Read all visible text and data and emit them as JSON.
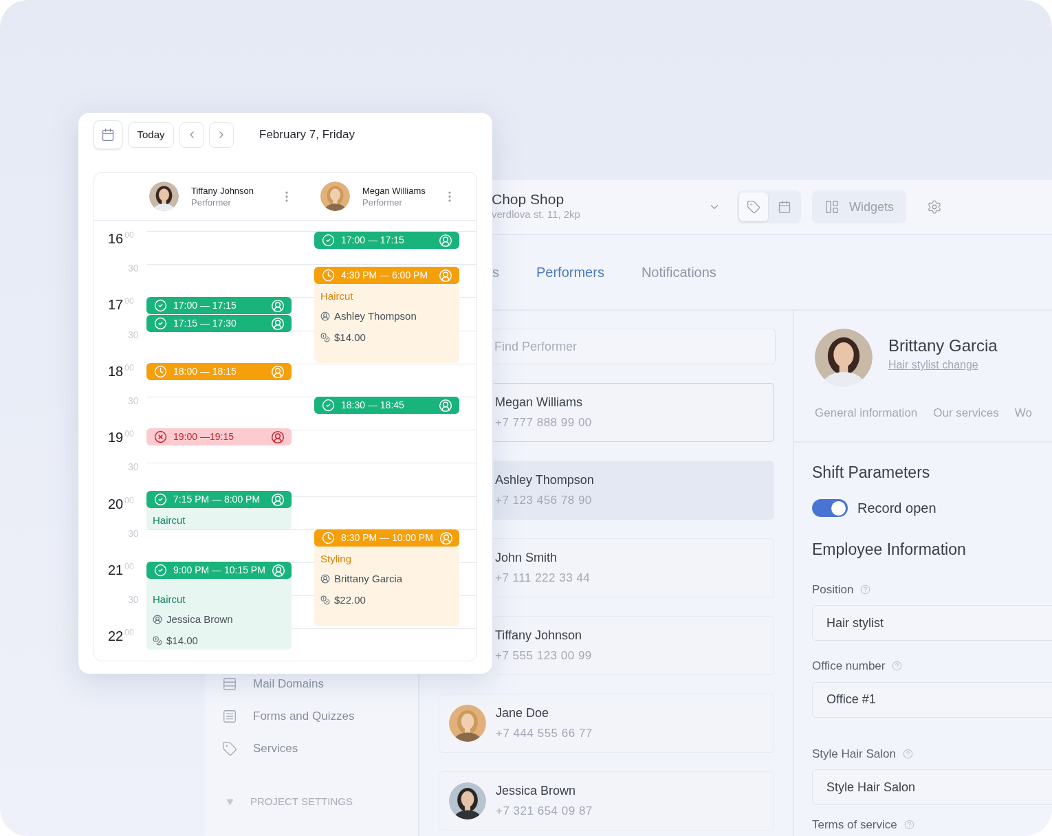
{
  "calendar": {
    "today": "Today",
    "date": "February 7, Friday",
    "performers": [
      {
        "name": "Tiffany Johnson",
        "role": "Performer",
        "photo": {
          "kind": "picture"
        }
      },
      {
        "name": "Megan Williams",
        "role": "Performer",
        "photo": {
          "kind": "picture"
        }
      }
    ],
    "time_labels": [
      {
        "kind": "hour",
        "hour": "16",
        "minutes": "00"
      },
      {
        "kind": "half",
        "minutes": "30"
      },
      {
        "kind": "hour",
        "hour": "17",
        "minutes": "00"
      },
      {
        "kind": "half",
        "minutes": "30"
      },
      {
        "kind": "hour",
        "hour": "18",
        "minutes": "00"
      },
      {
        "kind": "half",
        "minutes": "30"
      },
      {
        "kind": "hour",
        "hour": "19",
        "minutes": "00"
      },
      {
        "kind": "half",
        "minutes": "30"
      },
      {
        "kind": "hour",
        "hour": "20",
        "minutes": "00"
      },
      {
        "kind": "half",
        "minutes": "30"
      },
      {
        "kind": "hour",
        "hour": "21",
        "minutes": "00"
      },
      {
        "kind": "half",
        "minutes": "30"
      },
      {
        "kind": "hour",
        "hour": "22",
        "minutes": "00"
      }
    ],
    "columns": [
      {
        "events": [
          {
            "kind": "confirmed",
            "time": "17:00 — 17:15"
          },
          {
            "kind": "confirmed",
            "time": "17:15 — 17:30"
          },
          {
            "kind": "pending",
            "time": "18:00 — 18:15"
          },
          {
            "kind": "cancelled",
            "time": "19:00 —19:15"
          },
          {
            "kind": "confirmed",
            "time": "7:15 PM — 8:00 PM",
            "service": "Haircut"
          },
          {
            "kind": "confirmed",
            "time": "9:00 PM — 10:15 PM",
            "service": "Haircut",
            "client": "Jessica Brown",
            "price": "$14.00"
          }
        ]
      },
      {
        "events": [
          {
            "kind": "confirmed",
            "time": "17:00 — 17:15"
          },
          {
            "kind": "pending",
            "time": "4:30 PM — 6:00 PM",
            "service": "Haircut",
            "client": "Ashley Thompson",
            "price": "$14.00"
          },
          {
            "kind": "confirmed",
            "time": "18:30 — 18:45"
          },
          {
            "kind": "pending",
            "time": "8:30 PM — 10:00 PM",
            "service": "Styling",
            "client": "Brittany Garcia",
            "price": "$22.00"
          }
        ]
      }
    ]
  },
  "app": {
    "header": {
      "store_name": "Chop Shop",
      "store_address": "verdlova st. 11, 2kp",
      "view_toggle": [
        {
          "kind": "tag",
          "selected": true
        },
        {
          "kind": "calendar",
          "selected": false
        }
      ],
      "widgets": "Widgets"
    },
    "sidebar": {
      "items": [
        {
          "kind": "domains",
          "label": "Mail Domains"
        },
        {
          "kind": "forms",
          "label": "Forms and Quizzes"
        },
        {
          "kind": "tag",
          "label": "Services"
        }
      ],
      "section": "PROJECT SETTINGS"
    },
    "tabs": [
      {
        "label": "s",
        "selected": false
      },
      {
        "label": "Performers",
        "selected": true
      },
      {
        "label": "Notifications",
        "selected": false
      }
    ],
    "search": {
      "placeholder": "Find Performer"
    },
    "performers": [
      {
        "name": "Megan Williams",
        "phone": "+7 777 888 99 00",
        "selected": true,
        "highlighted": false
      },
      {
        "name": "Ashley Thompson",
        "phone": "+7 123 456 78 90",
        "selected": false,
        "highlighted": true
      },
      {
        "name": "John Smith",
        "phone": "+7 111 222 33 44",
        "selected": false,
        "highlighted": false
      },
      {
        "name": "Tiffany Johnson",
        "phone": "+7 555 123 00 99",
        "selected": false,
        "highlighted": false
      },
      {
        "name": "Jane Doe",
        "phone": "+7 444 555 66 77",
        "selected": false,
        "highlighted": false,
        "photo": {
          "kind": "picture"
        }
      },
      {
        "name": "Jessica Brown",
        "phone": "+7 321 654 09 87",
        "selected": false,
        "highlighted": false,
        "photo": {
          "kind": "picture"
        }
      }
    ],
    "profile": {
      "name": "Brittany Garcia",
      "link": "Hair stylist change",
      "photo": {
        "kind": "picture"
      },
      "subtabs": [
        "General information",
        "Our services",
        "Wo"
      ],
      "shift_title": "Shift Parameters",
      "toggle": {
        "label": "Record open",
        "on": true
      },
      "employee_title": "Employee Information",
      "fields": [
        {
          "label": "Position",
          "value": "Hair stylist"
        },
        {
          "label": "Office number",
          "value": "Office #1"
        },
        {
          "label": "Style Hair Salon",
          "value": "Style Hair Salon"
        },
        {
          "label": "Terms of service"
        }
      ]
    }
  }
}
